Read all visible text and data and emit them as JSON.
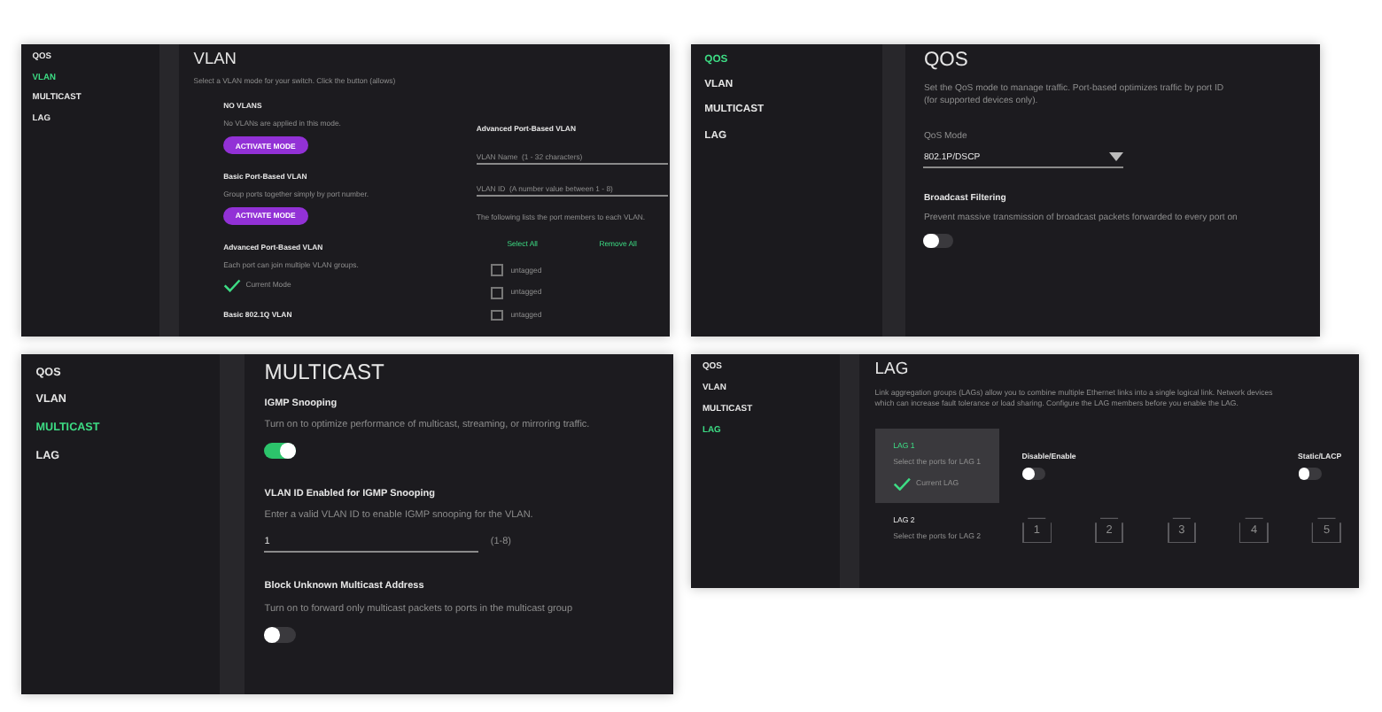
{
  "panels": [
    {
      "kind": "vlan",
      "sidebar": [
        {
          "label": "QOS",
          "selected": false
        },
        {
          "label": "VLAN",
          "selected": true
        },
        {
          "label": "MULTICAST",
          "selected": false
        },
        {
          "label": "LAG",
          "selected": false
        }
      ],
      "title": "VLAN",
      "description": [
        "Select a VLAN mode for your switch. Click the button (allows)"
      ],
      "modes": [
        {
          "name": "NO VLANS",
          "text": "No VLANs are applied in this mode.",
          "button": "ACTIVATE MODE"
        },
        {
          "name": "Basic Port-Based VLAN",
          "text": "Group ports together simply by port number.",
          "button": "ACTIVATE MODE"
        },
        {
          "name": "Advanced Port-Based VLAN",
          "text": "Each port can join multiple VLAN groups.",
          "status": "Current Mode"
        },
        {
          "name": "Basic 802.1Q VLAN"
        }
      ],
      "config": {
        "heading": "Advanced Port-Based VLAN",
        "fields": [
          {
            "placeholder": "VLAN Name  (1 - 32 characters)"
          },
          {
            "placeholder": "VLAN ID  (A number value between 1 - 8)"
          }
        ],
        "note": "The following lists the port members to each VLAN.",
        "links": [
          "Select All",
          "Remove All"
        ],
        "ports": [
          {
            "label": "untagged",
            "checked": false
          },
          {
            "label": "untagged",
            "checked": false
          },
          {
            "label": "untagged",
            "checked": false
          }
        ]
      }
    },
    {
      "kind": "qos",
      "sidebar": [
        {
          "label": "QOS",
          "selected": true
        },
        {
          "label": "VLAN",
          "selected": false
        },
        {
          "label": "MULTICAST",
          "selected": false
        },
        {
          "label": "LAG",
          "selected": false
        }
      ],
      "title": "QOS",
      "description": [
        "Set the QoS mode to manage traffic. Port-based optimizes traffic by port ID",
        "(for supported devices only)."
      ],
      "select": {
        "label": "QoS Mode",
        "value": "802.1P/DSCP"
      },
      "sections": [
        {
          "heading": "Broadcast Filtering",
          "text": "Prevent massive transmission of broadcast packets forwarded to every port on",
          "on": false
        }
      ]
    },
    {
      "kind": "multicast",
      "sidebar": [
        {
          "label": "QOS",
          "selected": false
        },
        {
          "label": "VLAN",
          "selected": false
        },
        {
          "label": "MULTICAST",
          "selected": true
        },
        {
          "label": "LAG",
          "selected": false
        }
      ],
      "title": "MULTICAST",
      "sections": [
        {
          "kind": "toggle",
          "heading": "IGMP Snooping",
          "text": "Turn on to optimize performance of multicast, streaming, or mirroring traffic.",
          "on": true
        },
        {
          "kind": "field",
          "heading": "VLAN ID Enabled for IGMP Snooping",
          "text": "Enter a valid VLAN ID to enable IGMP snooping for the VLAN.",
          "value": "1",
          "hint": "(1-8)"
        },
        {
          "kind": "toggle",
          "heading": "Block Unknown Multicast Address",
          "text": "Turn on to forward only multicast packets to ports in the multicast group",
          "on": false
        }
      ]
    },
    {
      "kind": "lag",
      "sidebar": [
        {
          "label": "QOS",
          "selected": false
        },
        {
          "label": "VLAN",
          "selected": false
        },
        {
          "label": "MULTICAST",
          "selected": false
        },
        {
          "label": "LAG",
          "selected": true
        }
      ],
      "title": "LAG",
      "description": [
        "Link aggregation groups (LAGs) allow you to combine multiple Ethernet links into a single logical link. Network devices",
        "which can increase fault tolerance or load sharing. Configure the LAG members before you enable the LAG."
      ],
      "groups": [
        {
          "name": "LAG 1",
          "text": "Select the ports for LAG 1",
          "status": "Current LAG",
          "selected": true
        },
        {
          "name": "LAG 2",
          "text": "Select the ports for LAG 2",
          "selected": false
        }
      ],
      "toggles": [
        {
          "label": "Disable/Enable",
          "on": false
        },
        {
          "label": "Static/LACP",
          "on": false
        }
      ],
      "ports": [
        "1",
        "2",
        "3",
        "4",
        "5"
      ]
    }
  ]
}
